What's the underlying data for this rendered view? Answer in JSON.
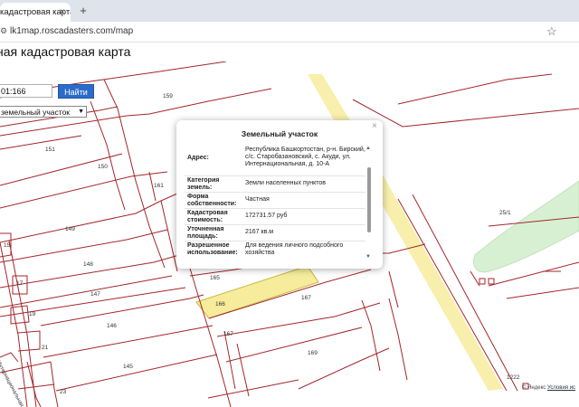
{
  "browser": {
    "tab_title": "кадастровая карта",
    "tab_close": "×",
    "new_tab": "+",
    "url": "lk1map.roscadasters.com/map",
    "bookmark_icon": "star-icon"
  },
  "page": {
    "title": "ная кадастровая карта"
  },
  "search": {
    "value": "01:166",
    "button_label": "Найти",
    "select_value": "земельный участок"
  },
  "popup": {
    "title": "Земельный участок",
    "close": "×",
    "rows": [
      {
        "label": "Адрес:",
        "value": "Республика Башкортостан, р-н. Бирский, с/с. Старобазановский, с. Акуди, ул. Интернациональная, д. 10-А"
      },
      {
        "label": "Категория земель:",
        "value": "Земли населенных пунктов"
      },
      {
        "label": "Форма собственности:",
        "value": "Частная"
      },
      {
        "label": "Кадастровая стоимость:",
        "value": "172731.57 руб"
      },
      {
        "label": "Уточненная площадь:",
        "value": "2167 кв.м"
      },
      {
        "label": "Разрешенное использование:",
        "value": "Для ведения личного подсобного хозяйства"
      }
    ]
  },
  "map": {
    "parcel_labels": [
      "159",
      "151",
      "150",
      "161",
      "149",
      "148",
      "147",
      "146",
      "145",
      "165",
      "166",
      "167",
      "167",
      "169",
      "25/1",
      "15",
      "17",
      "19",
      "21",
      "23",
      "1222"
    ],
    "street_label": "Интернациональная",
    "highlight_color": "#f6ec9c",
    "green_color": "#d8f0d2",
    "line_color": "#a4262c"
  },
  "attribution": {
    "yandex": "© Яндекс",
    "terms": "Условия ис"
  }
}
